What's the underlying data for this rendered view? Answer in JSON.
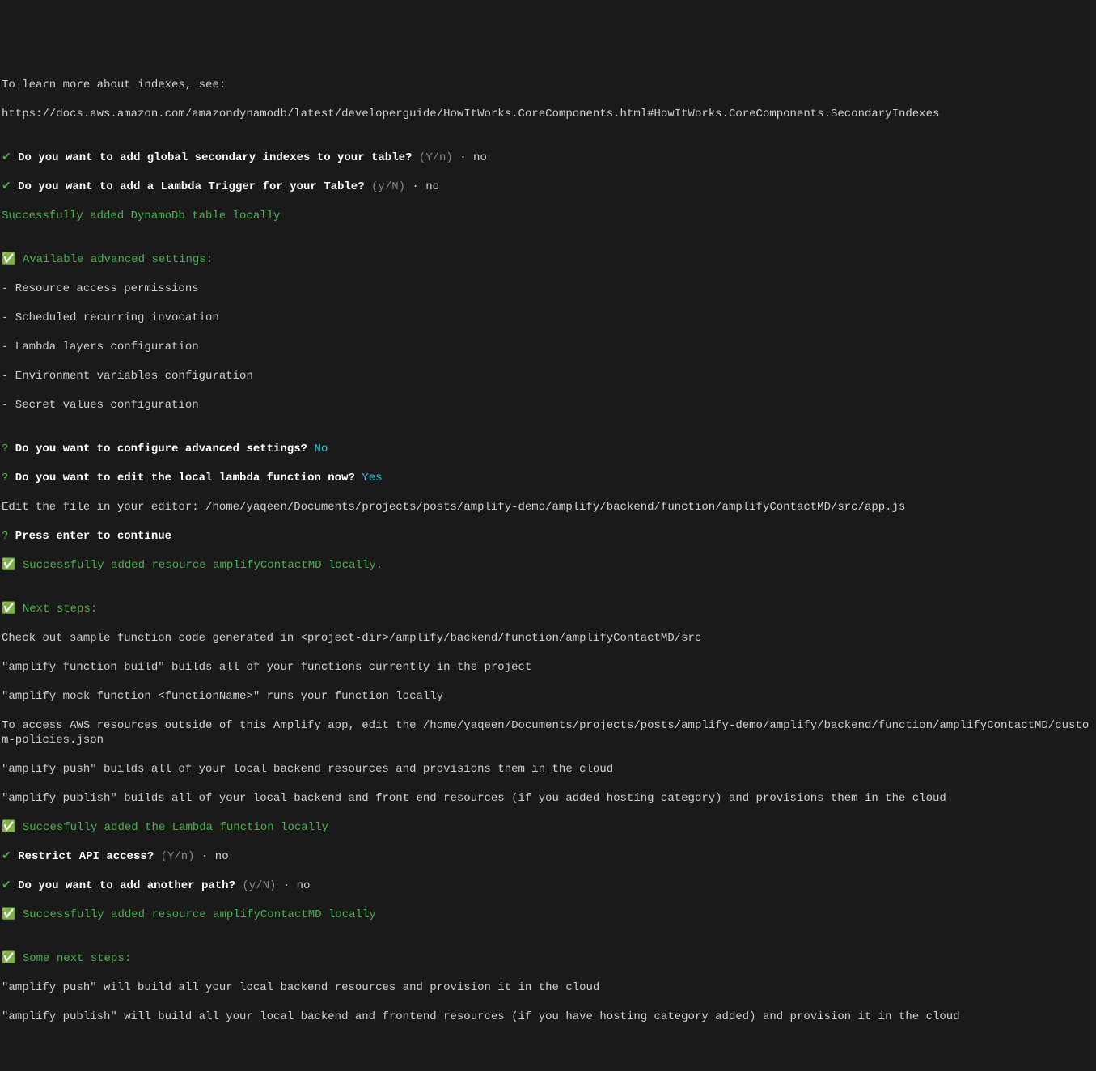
{
  "lines": {
    "l1": "To learn more about indexes, see:",
    "l2": "https://docs.aws.amazon.com/amazondynamodb/latest/developerguide/HowItWorks.CoreComponents.html#HowItWorks.CoreComponents.SecondaryIndexes",
    "blank1": "",
    "check1": "✔",
    "q1": " Do you want to add global secondary indexes to your table?",
    "q1hint": " (Y/n) ",
    "sep": "·",
    "q1ans": " no",
    "check2": "✔",
    "q2": " Do you want to add a Lambda Trigger for your Table?",
    "q2hint": " (y/N) ",
    "q2ans": " no",
    "success1": "Successfully added DynamoDb table locally",
    "blank2": "",
    "box1": "✅ ",
    "heading1": "Available advanced settings:",
    "opt1": "- Resource access permissions",
    "opt2": "- Scheduled recurring invocation",
    "opt3": "- Lambda layers configuration",
    "opt4": "- Environment variables configuration",
    "opt5": "- Secret values configuration",
    "blank3": "",
    "qmark": "?",
    "q3": " Do you want to configure advanced settings?",
    "q3ans": " No",
    "q4": " Do you want to edit the local lambda function now?",
    "q4ans": " Yes",
    "edit": "Edit the file in your editor: /home/yaqeen/Documents/projects/posts/amplify-demo/amplify/backend/function/amplifyContactMD/src/app.js",
    "q5": " Press enter to continue",
    "box2": "✅ ",
    "success2": "Successfully added resource amplifyContactMD locally.",
    "blank4": "",
    "box3": "✅ ",
    "heading2": "Next steps:",
    "ns1": "Check out sample function code generated in <project-dir>/amplify/backend/function/amplifyContactMD/src",
    "ns2": "\"amplify function build\" builds all of your functions currently in the project",
    "ns3": "\"amplify mock function <functionName>\" runs your function locally",
    "ns4": "To access AWS resources outside of this Amplify app, edit the /home/yaqeen/Documents/projects/posts/amplify-demo/amplify/backend/function/amplifyContactMD/custom-policies.json",
    "ns5": "\"amplify push\" builds all of your local backend resources and provisions them in the cloud",
    "ns6": "\"amplify publish\" builds all of your local backend and front-end resources (if you added hosting category) and provisions them in the cloud",
    "box4": "✅ ",
    "success3": "Succesfully added the Lambda function locally",
    "check3": "✔",
    "q6": " Restrict API access?",
    "q6hint": " (Y/n) ",
    "q6ans": " no",
    "check4": "✔",
    "q7": " Do you want to add another path?",
    "q7hint": " (y/N) ",
    "q7ans": " no",
    "box5": "✅ ",
    "success4": "Successfully added resource amplifyContactMD locally",
    "blank5": "",
    "box6": "✅ ",
    "heading3": "Some next steps:",
    "sn1": "\"amplify push\" will build all your local backend resources and provision it in the cloud",
    "sn2": "\"amplify publish\" will build all your local backend and frontend resources (if you have hosting category added) and provision it in the cloud"
  }
}
